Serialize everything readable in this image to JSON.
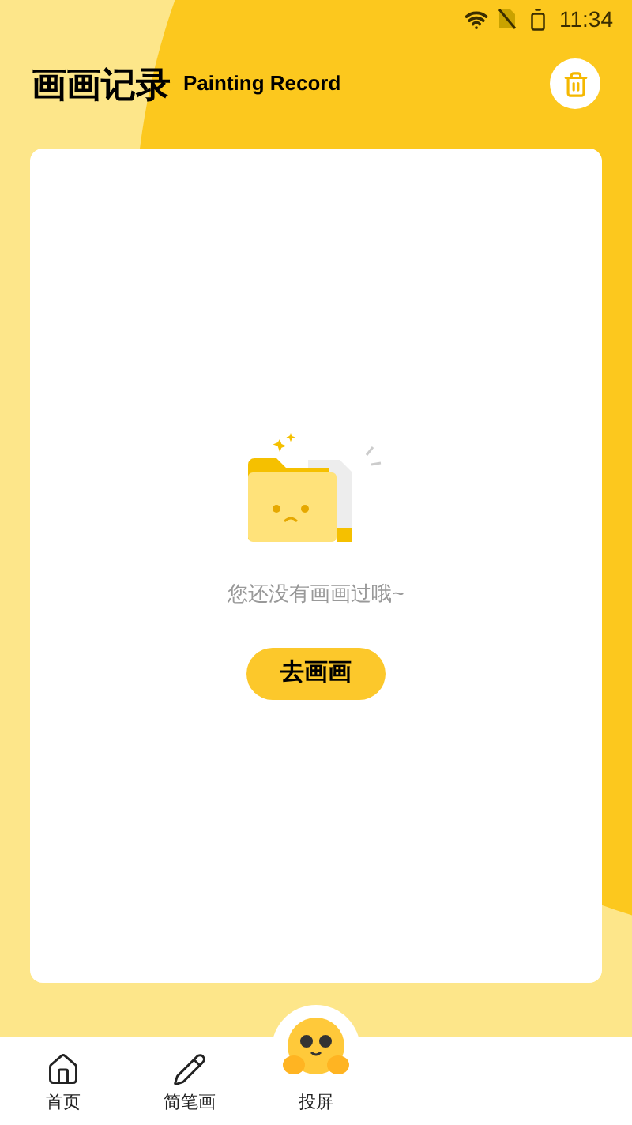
{
  "status_bar": {
    "time": "11:34"
  },
  "header": {
    "title": "画画记录",
    "subtitle": "Painting Record"
  },
  "empty_state": {
    "message": "您还没有画画过哦~",
    "button": "去画画"
  },
  "tab_bar": [
    {
      "kind": "home",
      "label": "首页",
      "selected": false
    },
    {
      "kind": "pencil",
      "label": "简笔画",
      "selected": false
    },
    {
      "kind": "mascot",
      "label": "投屏",
      "selected": false
    }
  ]
}
